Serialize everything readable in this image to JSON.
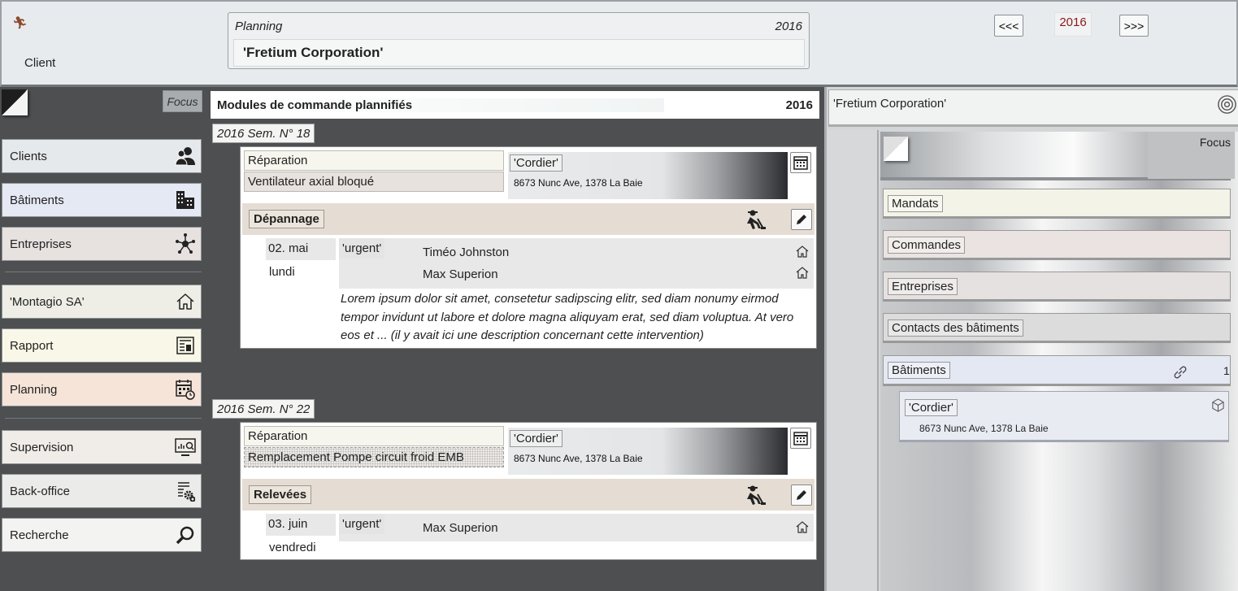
{
  "header": {
    "client_label": "Client",
    "planning_title": "Planning",
    "planning_year": "2016",
    "client_name": "'Fretium Corporation'",
    "prev_label": "<<<",
    "next_label": ">>>",
    "year": "2016"
  },
  "sidebar": {
    "focus_label": "Focus",
    "items": [
      {
        "label": "Clients",
        "icon": "users-icon",
        "color": "#e6e9eb"
      },
      {
        "label": "Bâtiments",
        "icon": "buildings-icon",
        "color": "#e4e9f4"
      },
      {
        "label": "Entreprises",
        "icon": "network-icon",
        "color": "#e7e1e0"
      },
      {
        "label": "'Montagio SA'",
        "icon": "home-icon",
        "color": "#eeeee7"
      },
      {
        "label": "Rapport",
        "icon": "report-icon",
        "color": "#f9f7e7"
      },
      {
        "label": "Planning",
        "icon": "calendar-clock-icon",
        "color": "#f6e4d9"
      },
      {
        "label": "Supervision",
        "icon": "monitor-icon",
        "color": "#f0ede9"
      },
      {
        "label": "Back-office",
        "icon": "settings-doc-icon",
        "color": "#ebebea"
      },
      {
        "label": "Recherche",
        "icon": "search-icon",
        "color": "#f3f3f1"
      }
    ]
  },
  "middle": {
    "title": "Modules de commande plannifiés",
    "year": "2016",
    "weeks": [
      {
        "label": "2016 Sem. N° 18",
        "type": "Réparation",
        "description": "Ventilateur axial bloqué",
        "building": "'Cordier'",
        "address": "8673 Nunc Ave, 1378 La Baie",
        "category": "Dépannage",
        "date": "02. mai",
        "weekday": "lundi",
        "priority": "'urgent'",
        "technicians": [
          "Timéo Johnston",
          "Max Superion"
        ],
        "note": "Lorem ipsum dolor sit amet, consetetur sadipscing elitr, sed diam nonumy eirmod tempor invidunt ut labore et dolore magna aliquyam erat, sed diam voluptua. At vero eos et ... (il y avait ici une description concernant cette intervention)"
      },
      {
        "label": "2016 Sem. N° 22",
        "type": "Réparation",
        "description": "Remplacement Pompe circuit froid EMB",
        "building": "'Cordier'",
        "address": "8673 Nunc Ave, 1378 La Baie",
        "category": "Relevées",
        "date": "03. juin",
        "weekday": "vendredi",
        "priority": "'urgent'",
        "technicians": [
          "Max Superion"
        ]
      }
    ]
  },
  "right": {
    "client_name": "'Fretium Corporation'",
    "focus_label": "Focus",
    "items": [
      {
        "label": "Mandats",
        "color": "#f3f3e8"
      },
      {
        "label": "Commandes",
        "color": "#eae3e1"
      },
      {
        "label": "Entreprises",
        "color": "#e6e1e1"
      },
      {
        "label": "Contacts des bâtiments",
        "color": "#dcdcdc"
      },
      {
        "label": "Bâtiments",
        "color": "#e4e8f3"
      }
    ],
    "buildings_count": "1",
    "building_name": "'Cordier'",
    "building_address": "8673 Nunc Ave, 1378 La Baie"
  }
}
